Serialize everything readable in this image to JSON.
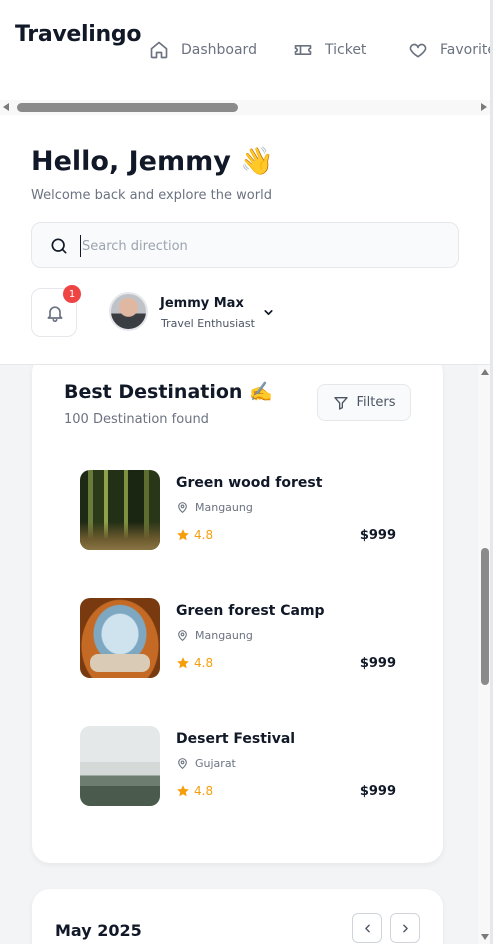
{
  "app": {
    "logo": "Travelingo"
  },
  "nav": [
    {
      "label": "Dashboard",
      "icon": "home-icon"
    },
    {
      "label": "Ticket",
      "icon": "ticket-icon"
    },
    {
      "label": "Favorite",
      "icon": "heart-icon"
    }
  ],
  "header": {
    "greeting": "Hello, Jemmy 👋",
    "subtitle": "Welcome back and explore the world",
    "search_placeholder": "Search direction",
    "notifications_count": "1",
    "user": {
      "name": "Jemmy Max",
      "role": "Travel Enthusiast"
    }
  },
  "destinations": {
    "title": "Best Destination ✍️",
    "found": "100 Destination found",
    "filters_label": "Filters",
    "items": [
      {
        "name": "Green wood forest",
        "location": "Mangaung",
        "rating": "4.8",
        "price": "$999"
      },
      {
        "name": "Green forest Camp",
        "location": "Mangaung",
        "rating": "4.8",
        "price": "$999"
      },
      {
        "name": "Desert Festival",
        "location": "Gujarat",
        "rating": "4.8",
        "price": "$999"
      }
    ]
  },
  "calendar": {
    "month": "May 2025"
  },
  "colors": {
    "accent_star": "#f59e0b",
    "badge": "#ef4444",
    "text": "#111827",
    "muted": "#6b7280"
  }
}
